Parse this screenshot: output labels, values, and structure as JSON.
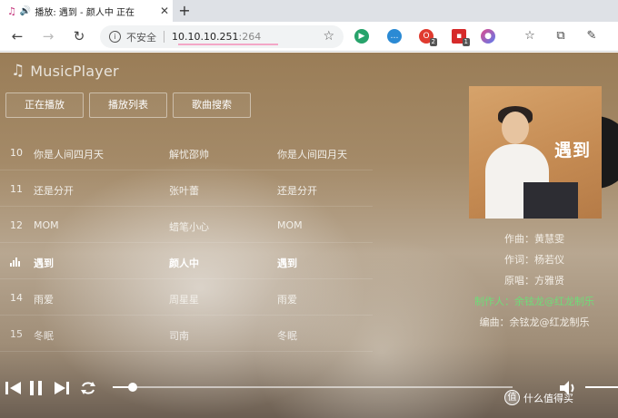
{
  "browser": {
    "tab_title": "播放: 遇到 - 颜人中 正在",
    "tab_favicon": "music-note-icon",
    "url_security": "不安全",
    "url_host": "10.10.10.251",
    "url_port": ":264",
    "extension_badges": [
      "2",
      "1"
    ]
  },
  "app": {
    "name": "MusicPlayer",
    "buttons": [
      "正在播放",
      "播放列表",
      "歌曲搜索"
    ]
  },
  "playlist": [
    {
      "num": "10",
      "song": "你是人间四月天",
      "artist": "解忧邵帅",
      "album": "你是人间四月天"
    },
    {
      "num": "11",
      "song": "还是分开",
      "artist": "张叶蕾",
      "album": "还是分开"
    },
    {
      "num": "12",
      "song": "MOM",
      "artist": "蜡笔小心",
      "album": "MOM"
    },
    {
      "num": "",
      "song": "遇到",
      "artist": "颜人中",
      "album": "遇到",
      "playing": true
    },
    {
      "num": "14",
      "song": "雨爱",
      "artist": "周星星",
      "album": "雨爱"
    },
    {
      "num": "15",
      "song": "冬眠",
      "artist": "司南",
      "album": "冬眠"
    }
  ],
  "now_playing": {
    "cover_title": "遇到",
    "credits": [
      {
        "text": "作曲：黄慧雯",
        "color": "#f3eee6"
      },
      {
        "text": "作词：杨若仪",
        "color": "#f3eee6"
      },
      {
        "text": "原唱：方雅贤",
        "color": "#f3eee6"
      },
      {
        "text": "制作人：余铉龙@红龙制乐",
        "color": "#6fdc78"
      },
      {
        "text": "编曲：余铉龙@红龙制乐",
        "color": "#f3eee6"
      }
    ],
    "progress": 0.05,
    "volume": 1.0
  },
  "watermark": "值 什么值得买"
}
